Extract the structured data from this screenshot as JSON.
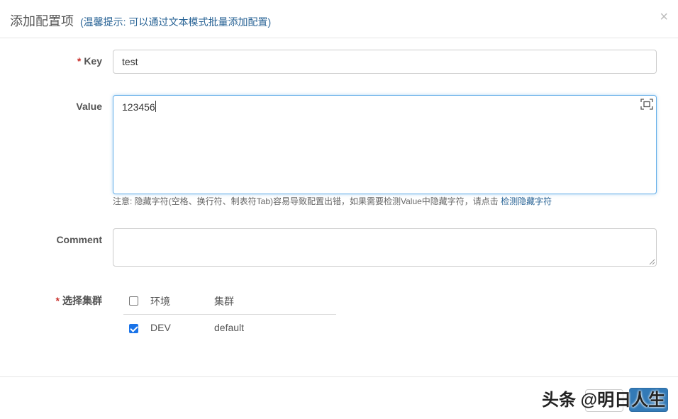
{
  "header": {
    "title": "添加配置项",
    "hint": "(温馨提示: 可以通过文本模式批量添加配置)",
    "close": "×"
  },
  "form": {
    "required_mark": "*",
    "key_label": "Key",
    "key_value": "test",
    "value_label": "Value",
    "value_value": "123456",
    "note_text": "注意: 隐藏字符(空格、换行符、制表符Tab)容易导致配置出错，如果需要检测Value中隐藏字符，请点击",
    "note_link": "检测隐藏字符",
    "comment_label": "Comment",
    "comment_value": "",
    "cluster_label": "选择集群"
  },
  "cluster_table": {
    "headers": [
      "环境",
      "集群"
    ],
    "rows": [
      {
        "env": "DEV",
        "cluster": "default",
        "checked": true
      }
    ],
    "select_all_checked": false
  },
  "footer": {
    "cancel_label": "",
    "submit_label": ""
  },
  "watermark": "头条 @明日人生"
}
